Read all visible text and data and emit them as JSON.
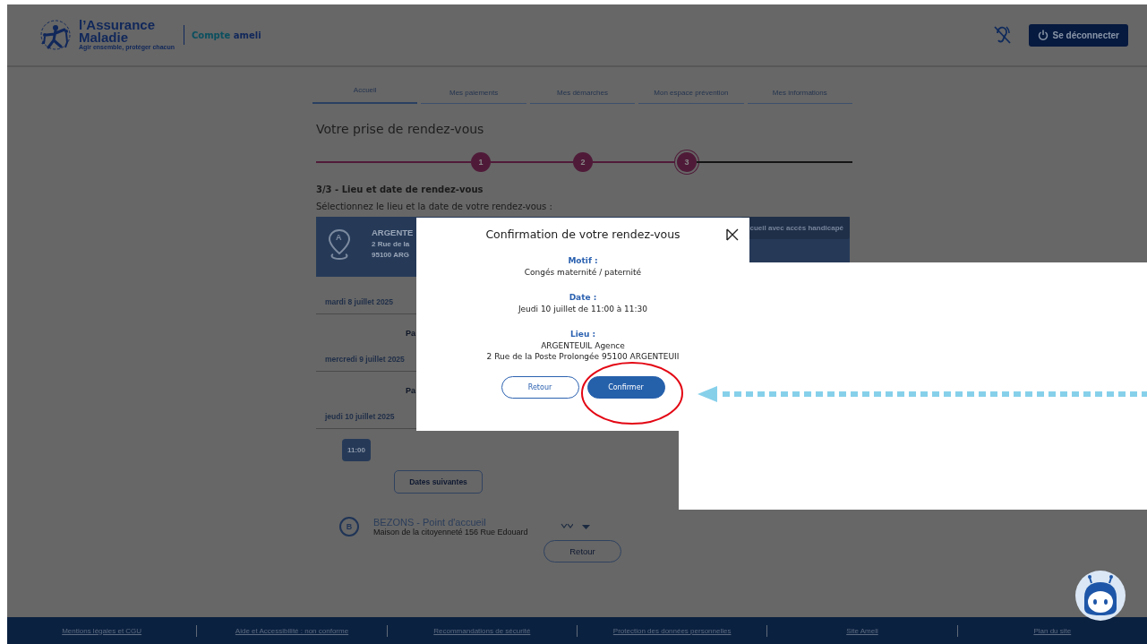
{
  "header": {
    "logo": {
      "title": "l’Assurance",
      "subtitle": "Maladie",
      "tagline": "Agir ensemble, protéger chacun"
    },
    "account": {
      "prefix": "Compte",
      "name": "ameli"
    },
    "logout_button": "Se déconnecter"
  },
  "tabs": [
    {
      "label": "Accueil",
      "selected": true
    },
    {
      "label": "Mes paiements",
      "selected": false
    },
    {
      "label": "Mes démarches",
      "selected": false
    },
    {
      "label": "Mon espace prévention",
      "selected": false
    },
    {
      "label": "Mes informations",
      "selected": false
    }
  ],
  "page_title": "Votre prise de rendez-vous",
  "stepper": [
    {
      "label": "1",
      "current": false
    },
    {
      "label": "2",
      "current": false
    },
    {
      "label": "3",
      "current": true
    }
  ],
  "step_heading": "3/3 - Lieu et date de rendez-vous",
  "instruction": "Sélectionnez le lieu et la date de votre rendez-vous :",
  "filter_button": "cueil avec accès handicapé",
  "locations": [
    {
      "marker": "A",
      "name": "ARGENTE",
      "address_lines": [
        "2 Rue de la",
        "95100 ARG"
      ],
      "expanded": true,
      "days": [
        {
          "date": "mardi 8 juillet 2025",
          "note": "Pa"
        },
        {
          "date": "mercredi 9 juillet 2025",
          "note": "Pa"
        },
        {
          "date": "jeudi 10 juillet 2025",
          "slots": [
            "11:00"
          ]
        }
      ],
      "next_button": "Dates suivantes"
    },
    {
      "marker": "B",
      "name": "BEZONS - Point d'accueil",
      "address_lines": [
        "Maison de la citoyenneté 156 Rue Edouard"
      ],
      "expanded": false
    }
  ],
  "back_button": "Retour",
  "modal": {
    "title": "Confirmation de votre rendez-vous",
    "sections": [
      {
        "label": "Motif :",
        "lines": [
          "Congés maternité / paternité"
        ]
      },
      {
        "label": "Date :",
        "lines": [
          "Jeudi 10 juillet de 11:00 à 11:30"
        ]
      },
      {
        "label": "Lieu :",
        "lines": [
          "ARGENTEUIL Agence",
          "2 Rue de la Poste Prolongée 95100 ARGENTEUII"
        ]
      }
    ],
    "buttons": [
      {
        "label": "Retour",
        "kind": "secondary"
      },
      {
        "label": "Confirmer",
        "kind": "primary"
      }
    ]
  },
  "footer_links": [
    "Mentions légales et CGU",
    "Aide et Accessibilité : non conforme",
    "Recommandations de sécurité",
    "Protection des données personnelles",
    "Site Ameli",
    "Plan du site"
  ]
}
